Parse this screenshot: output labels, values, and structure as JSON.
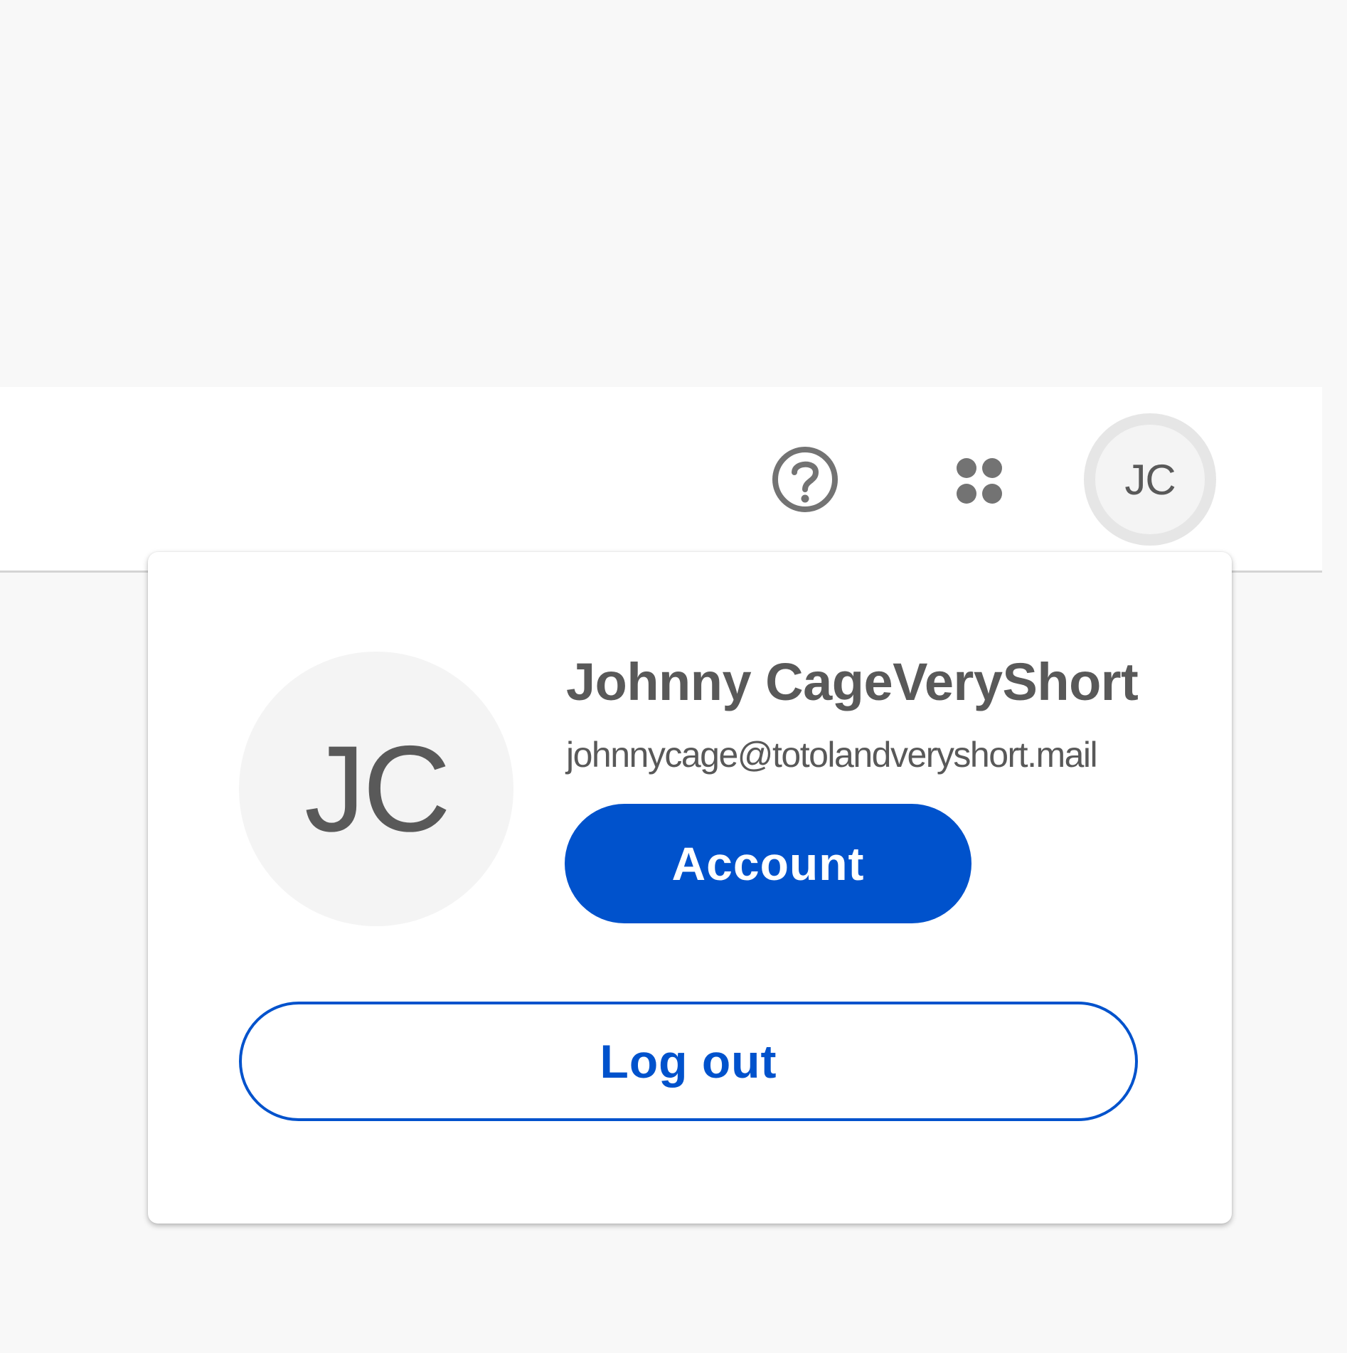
{
  "header": {
    "help_icon": "question-circle-icon",
    "apps_icon": "four-dot-grid-icon",
    "avatar_initials": "JC"
  },
  "profile_menu": {
    "avatar_initials": "JC",
    "user_name": "Johnny CageVeryShort",
    "user_email": "johnnycage@totolandveryshort.mail",
    "account_label": "Account",
    "logout_label": "Log out"
  },
  "colors": {
    "background": "#f8f8f8",
    "header_background": "#ffffff",
    "icon_gray": "#737373",
    "text_gray": "#595959",
    "avatar_background": "#f4f4f4",
    "avatar_ring": "#e6e6e6",
    "primary_blue": "#0052cc"
  }
}
